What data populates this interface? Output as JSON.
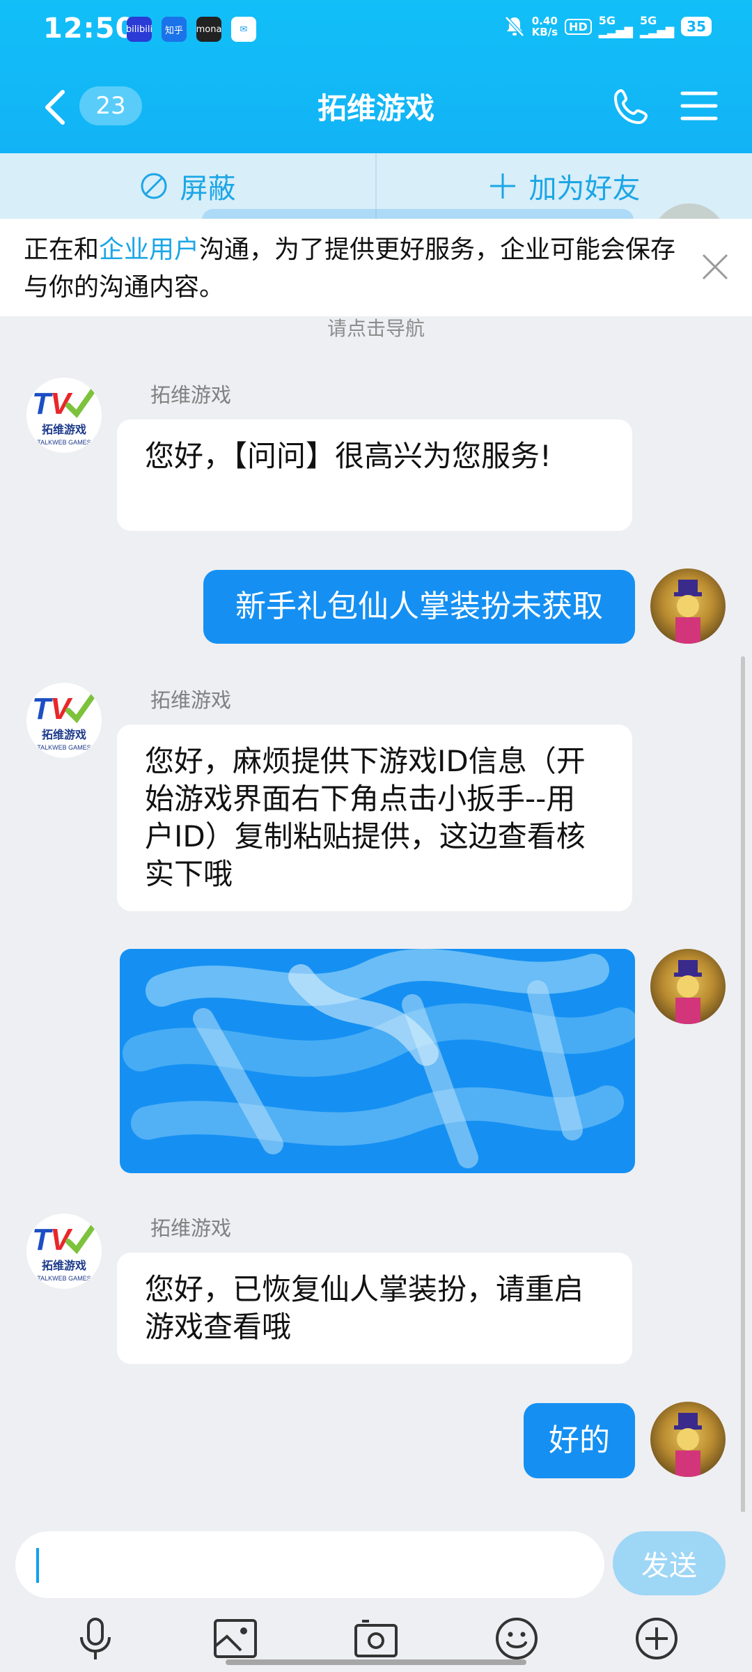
{
  "status_bar": {
    "time": "12:50",
    "app_icons": [
      "bilibili-icon",
      "zhihu-icon",
      "game-app-icon",
      "mail-icon"
    ],
    "app_icon_labels": [
      "bilibili",
      "知乎",
      "mona",
      "✉"
    ],
    "network_speed_value": "0.40",
    "network_speed_unit": "KB/s",
    "hd_label": "HD",
    "sim1": "5G",
    "sim2": "5G",
    "battery": "35"
  },
  "header": {
    "unread_count": "23",
    "title": "拓维游戏"
  },
  "action_bar": {
    "block_label": "屏蔽",
    "add_friend_label": "加为好友"
  },
  "notice": {
    "prefix": "正在和",
    "highlight": "企业用户",
    "suffix": "沟通，为了提供更好服务，企业可能会保存与你的沟通内容。"
  },
  "system_message": "请点击导航",
  "messages": [
    {
      "side": "left",
      "sender": "拓维游戏",
      "text": "您好，【问问】很高兴为您服务!"
    },
    {
      "side": "right",
      "text": "新手礼包仙人掌装扮未获取"
    },
    {
      "side": "left",
      "sender": "拓维游戏",
      "text": "您好，麻烦提供下游戏ID信息（开始游戏界面右下角点击小扳手--用户ID）复制粘贴提供，这边查看核实下哦"
    },
    {
      "side": "right",
      "text": ""
    },
    {
      "side": "left",
      "sender": "拓维游戏",
      "text": "您好，已恢复仙人掌装扮，请重启游戏查看哦"
    },
    {
      "side": "right",
      "text": "好的"
    }
  ],
  "avatar": {
    "brand_name": "拓维游戏",
    "brand_sub": "TALKWEB GAMES"
  },
  "input": {
    "value": "",
    "send_label": "发送"
  },
  "toolbar": {
    "icons": [
      "microphone-icon",
      "image-icon",
      "camera-icon",
      "emoji-icon",
      "plus-icon"
    ]
  },
  "colors": {
    "header": "#12b8f7",
    "bubble_right": "#1590f2",
    "accent": "#1ba6e6"
  }
}
